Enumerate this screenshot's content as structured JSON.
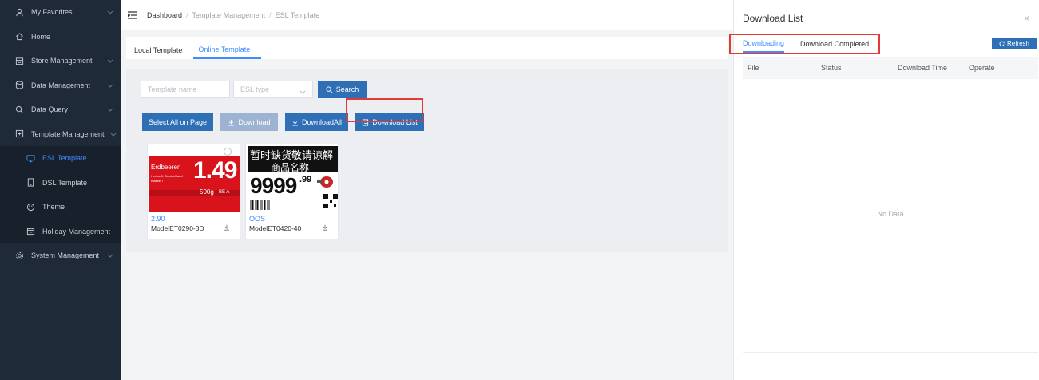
{
  "sidebar": {
    "items": [
      {
        "label": "My Favorites",
        "icon": "user-icon",
        "expandable": true
      },
      {
        "label": "Home",
        "icon": "home-icon",
        "expandable": false
      },
      {
        "label": "Store Management",
        "icon": "store-icon",
        "expandable": true
      },
      {
        "label": "Data Management",
        "icon": "database-icon",
        "expandable": true
      },
      {
        "label": "Data Query",
        "icon": "search-icon",
        "expandable": true
      },
      {
        "label": "Template Management",
        "icon": "template-icon",
        "expandable": true
      }
    ],
    "sub_items": [
      {
        "label": "ESL Template",
        "icon": "monitor-icon",
        "active": true
      },
      {
        "label": "DSL Template",
        "icon": "tablet-icon",
        "active": false
      },
      {
        "label": "Theme",
        "icon": "palette-icon",
        "active": false
      },
      {
        "label": "Holiday Management",
        "icon": "calendar-icon",
        "active": false
      }
    ],
    "after": [
      {
        "label": "System Management",
        "icon": "gear-icon",
        "expandable": true
      }
    ]
  },
  "breadcrumb": {
    "root": "Dashboard",
    "level2": "Template Management",
    "current": "ESL Template"
  },
  "tabs": {
    "local": "Local Template",
    "online": "Online Template"
  },
  "filter": {
    "name_placeholder": "Template name",
    "type_placeholder": "ESL type",
    "search_label": "Search"
  },
  "actions": {
    "select_all": "Select All on Page",
    "download": "Download",
    "download_all": "DownloadAll",
    "download_list": "Download List"
  },
  "cards": [
    {
      "meta": "2.90",
      "name": "ModelET0290-3D",
      "tag": {
        "product": "Erdbeeren",
        "price": "1.49",
        "lines": [
          "Herkunft: Deutschland",
          "Klasse: I"
        ],
        "unit_price": "500g",
        "unit_extra": "BE  A"
      }
    },
    {
      "meta": "OOS",
      "name": "ModelET0420-40",
      "tag": {
        "line1": "暂时缺货敬请谅解",
        "line2": "商品名称",
        "price": "9999",
        "cents": ".99"
      }
    }
  ],
  "drawer": {
    "title": "Download List",
    "close": "×",
    "tab_downloading": "Downloading",
    "tab_completed": "Download Completed",
    "refresh": "Refresh",
    "columns": [
      "File",
      "Status",
      "Download Time",
      "Operate"
    ],
    "empty": "No Data"
  },
  "colors": {
    "sidebar_bg": "#1f2a38",
    "accent": "#3f8cff",
    "button": "#2e6fb5",
    "highlight": "#e53935",
    "tag_red": "#d8131b"
  }
}
